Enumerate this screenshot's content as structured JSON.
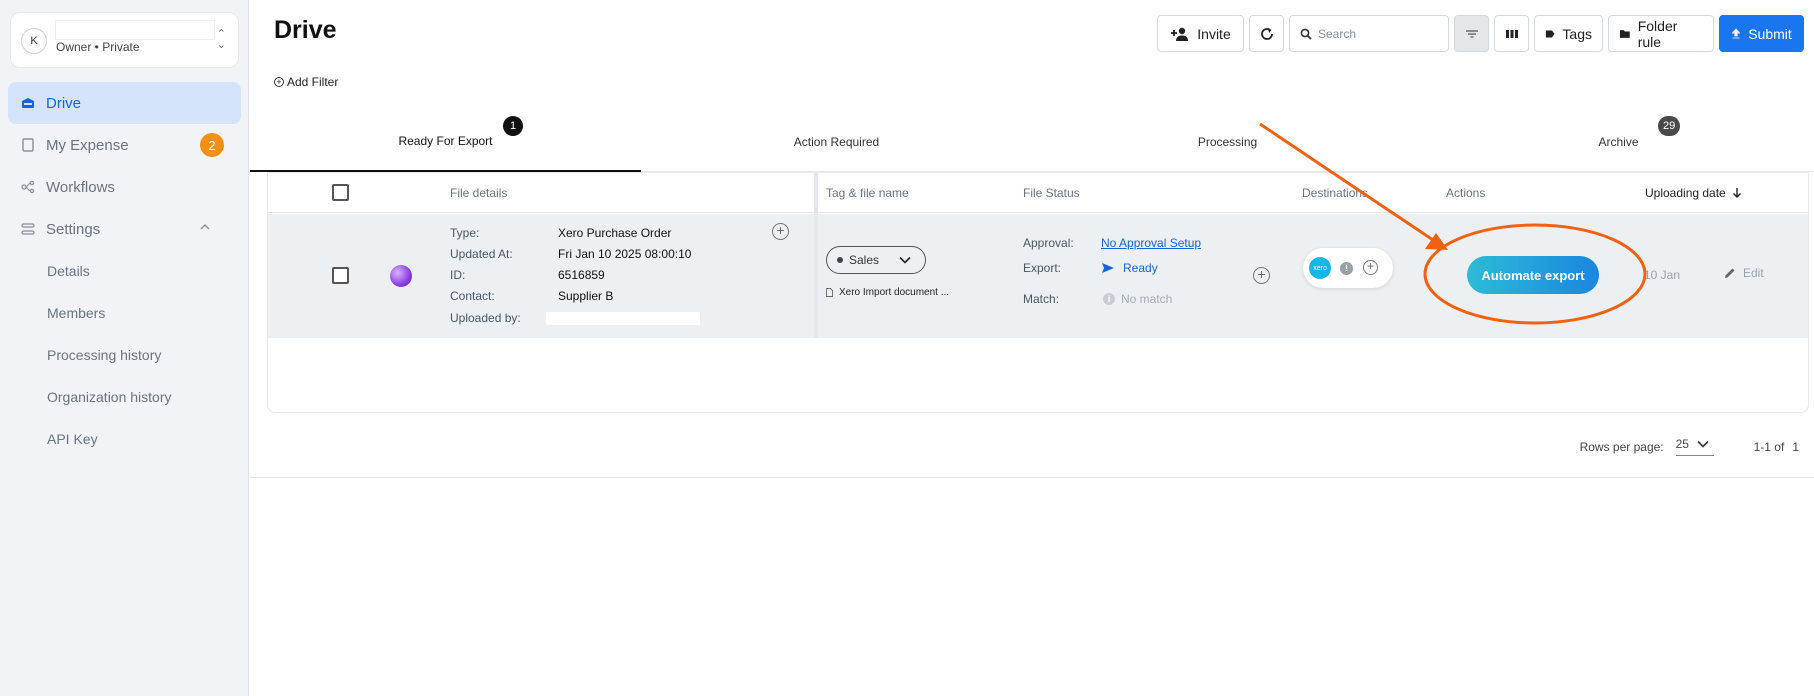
{
  "org": {
    "avatar_initial": "K",
    "name": "",
    "role": "Owner • Private"
  },
  "sidebar": {
    "items": [
      {
        "label": "Drive",
        "icon": "drive-icon",
        "active": true
      },
      {
        "label": "My Expense",
        "icon": "receipt-icon",
        "badge": "2"
      },
      {
        "label": "Workflows",
        "icon": "workflow-icon"
      },
      {
        "label": "Settings",
        "icon": "settings-icon",
        "expanded": true
      }
    ],
    "settings_items": [
      "Details",
      "Members",
      "Processing history",
      "Organization history",
      "API Key"
    ]
  },
  "header": {
    "title": "Drive",
    "add_filter": "Add Filter",
    "toolbar": {
      "invite": "Invite",
      "search_placeholder": "Search",
      "tags": "Tags",
      "folder_rule": "Folder rule",
      "submit": "Submit"
    }
  },
  "tabs": [
    {
      "label": "Ready For Export",
      "badge": "1",
      "active": true
    },
    {
      "label": "Action Required"
    },
    {
      "label": "Processing"
    },
    {
      "label": "Archive",
      "badge": "29"
    }
  ],
  "table": {
    "columns": [
      "File details",
      "Tag & file name",
      "File Status",
      "Destinations",
      "Actions",
      "Uploading date"
    ],
    "rows": [
      {
        "details": [
          {
            "key": "Type:",
            "value": "Xero Purchase Order"
          },
          {
            "key": "Updated At:",
            "value": "Fri Jan 10 2025 08:00:10"
          },
          {
            "key": "ID:",
            "value": "6516859"
          },
          {
            "key": "Contact:",
            "value": "Supplier B"
          },
          {
            "key": "Uploaded by:",
            "value": ""
          }
        ],
        "tag": "Sales",
        "file_name": "Xero Import document ...",
        "status": {
          "approval_label": "Approval:",
          "approval_value": "No Approval Setup",
          "export_label": "Export:",
          "export_value": "Ready",
          "match_label": "Match:",
          "match_value": "No match"
        },
        "destination_logo": "xero",
        "action": "Automate export",
        "date": "10 Jan",
        "edit": "Edit"
      }
    ]
  },
  "pagination": {
    "rows_per_page_label": "Rows per page:",
    "rows_per_page": "25",
    "range": "1-1 of",
    "total": "1"
  },
  "colors": {
    "accent": "#1976f0",
    "active_nav_bg": "#d6e4fb",
    "badge_orange": "#f59014",
    "annotation": "#f2610f"
  }
}
